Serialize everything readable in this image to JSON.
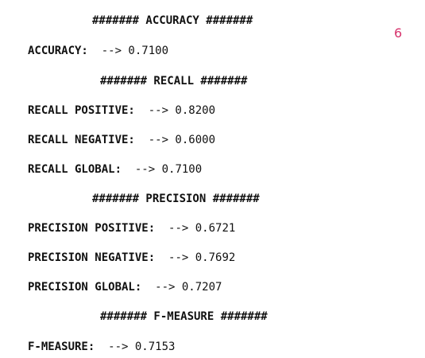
{
  "page_number": "6",
  "sections": {
    "accuracy": {
      "header": "####### ACCURACY #######",
      "rows": [
        {
          "label": "ACCURACY:",
          "value": "--> 0.7100"
        }
      ]
    },
    "recall": {
      "header": "####### RECALL #######",
      "rows": [
        {
          "label": "RECALL POSITIVE:",
          "value": "--> 0.8200"
        },
        {
          "label": "RECALL NEGATIVE:",
          "value": "--> 0.6000"
        },
        {
          "label": "RECALL GLOBAL:",
          "value": "--> 0.7100"
        }
      ]
    },
    "precision": {
      "header": "####### PRECISION #######",
      "rows": [
        {
          "label": "PRECISION POSITIVE:",
          "value": "--> 0.6721"
        },
        {
          "label": "PRECISION NEGATIVE:",
          "value": "--> 0.7692"
        },
        {
          "label": "PRECISION GLOBAL:",
          "value": "--> 0.7207"
        }
      ]
    },
    "fmeasure": {
      "header": "####### F-MEASURE #######",
      "rows": [
        {
          "label": "F-MEASURE:",
          "value": "--> 0.7153"
        }
      ]
    }
  }
}
